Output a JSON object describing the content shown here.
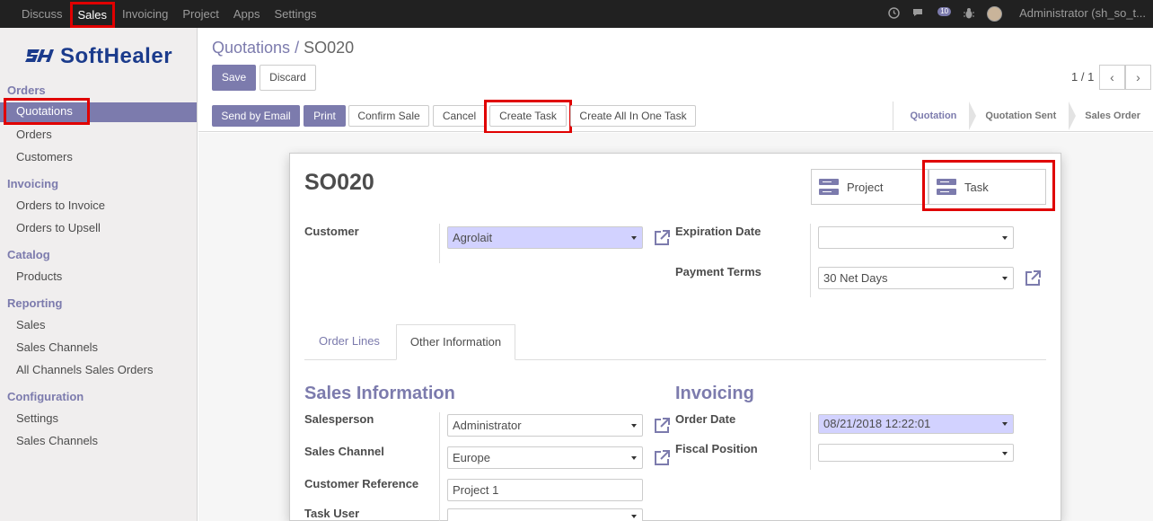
{
  "topbar": {
    "menu": [
      "Discuss",
      "Sales",
      "Invoicing",
      "Project",
      "Apps",
      "Settings"
    ],
    "active": "Sales",
    "messages_count": "10",
    "user": "Administrator (sh_so_t..."
  },
  "sidebar": {
    "logo": "SoftHealer",
    "logo_mark": "SH",
    "sections": [
      {
        "title": "Orders",
        "items": [
          "Quotations",
          "Orders",
          "Customers"
        ]
      },
      {
        "title": "Invoicing",
        "items": [
          "Orders to Invoice",
          "Orders to Upsell"
        ]
      },
      {
        "title": "Catalog",
        "items": [
          "Products"
        ]
      },
      {
        "title": "Reporting",
        "items": [
          "Sales",
          "Sales Channels",
          "All Channels Sales Orders"
        ]
      },
      {
        "title": "Configuration",
        "items": [
          "Settings",
          "Sales Channels"
        ]
      }
    ]
  },
  "breadcrumb": {
    "parent": "Quotations",
    "sep": "/",
    "current": "SO020"
  },
  "buttons": {
    "save": "Save",
    "discard": "Discard",
    "send_email": "Send by Email",
    "print": "Print",
    "confirm": "Confirm Sale",
    "cancel": "Cancel",
    "create_task": "Create Task",
    "create_all": "Create All In One Task"
  },
  "pager": {
    "value": "1 / 1",
    "prev": "‹",
    "next": "›"
  },
  "statusbar": [
    "Quotation",
    "Quotation Sent",
    "Sales Order"
  ],
  "status_active": "Quotation",
  "form": {
    "title": "SO020",
    "smart_buttons": [
      "Project",
      "Task"
    ],
    "customer_label": "Customer",
    "customer": "Agrolait",
    "expiration_label": "Expiration Date",
    "expiration": "",
    "payment_terms_label": "Payment Terms",
    "payment_terms": "30 Net Days",
    "tabs": [
      "Order Lines",
      "Other Information"
    ],
    "active_tab": "Other Information",
    "sales_info_title": "Sales Information",
    "invoicing_title": "Invoicing",
    "salesperson_label": "Salesperson",
    "salesperson": "Administrator",
    "sales_channel_label": "Sales Channel",
    "sales_channel": "Europe",
    "customer_ref_label": "Customer Reference",
    "customer_ref": "Project 1",
    "task_user_label": "Task User",
    "task_user": "",
    "order_date_label": "Order Date",
    "order_date": "08/21/2018 12:22:01",
    "fiscal_position_label": "Fiscal Position",
    "fiscal_position": ""
  },
  "colors": {
    "accent": "#7c7bad",
    "highlight": "#e00000",
    "topbar": "#212121"
  }
}
